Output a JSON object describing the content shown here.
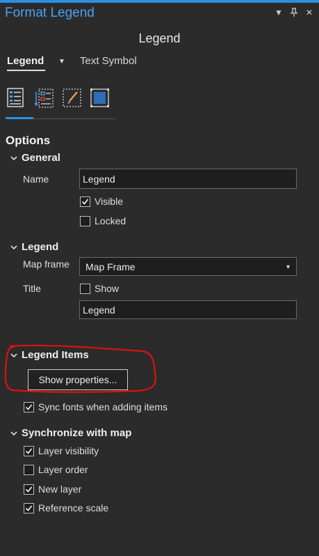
{
  "window": {
    "title": "Format Legend"
  },
  "header": {
    "heading": "Legend"
  },
  "tabs": [
    {
      "label": "Legend",
      "active": true
    },
    {
      "label": "Text Symbol",
      "active": false
    }
  ],
  "options": {
    "title": "Options",
    "general": {
      "title": "General",
      "name_label": "Name",
      "name_value": "Legend",
      "visible_label": "Visible",
      "visible_checked": true,
      "locked_label": "Locked",
      "locked_checked": false
    },
    "legend": {
      "title": "Legend",
      "map_frame_label": "Map frame",
      "map_frame_value": "Map Frame",
      "title_label": "Title",
      "show_label": "Show",
      "show_checked": false,
      "title_value": "Legend"
    },
    "legend_items": {
      "title": "Legend Items",
      "show_properties_label": "Show properties...",
      "sync_fonts_label": "Sync fonts when adding items",
      "sync_fonts_checked": true
    },
    "synchronize": {
      "title": "Synchronize with map",
      "items": [
        {
          "label": "Layer visibility",
          "checked": true
        },
        {
          "label": "Layer order",
          "checked": false
        },
        {
          "label": "New layer",
          "checked": true
        },
        {
          "label": "Reference scale",
          "checked": true
        }
      ]
    }
  },
  "colors": {
    "accent": "#2b8fe0",
    "annotation": "#e01010",
    "background": "#2b2b2b"
  }
}
